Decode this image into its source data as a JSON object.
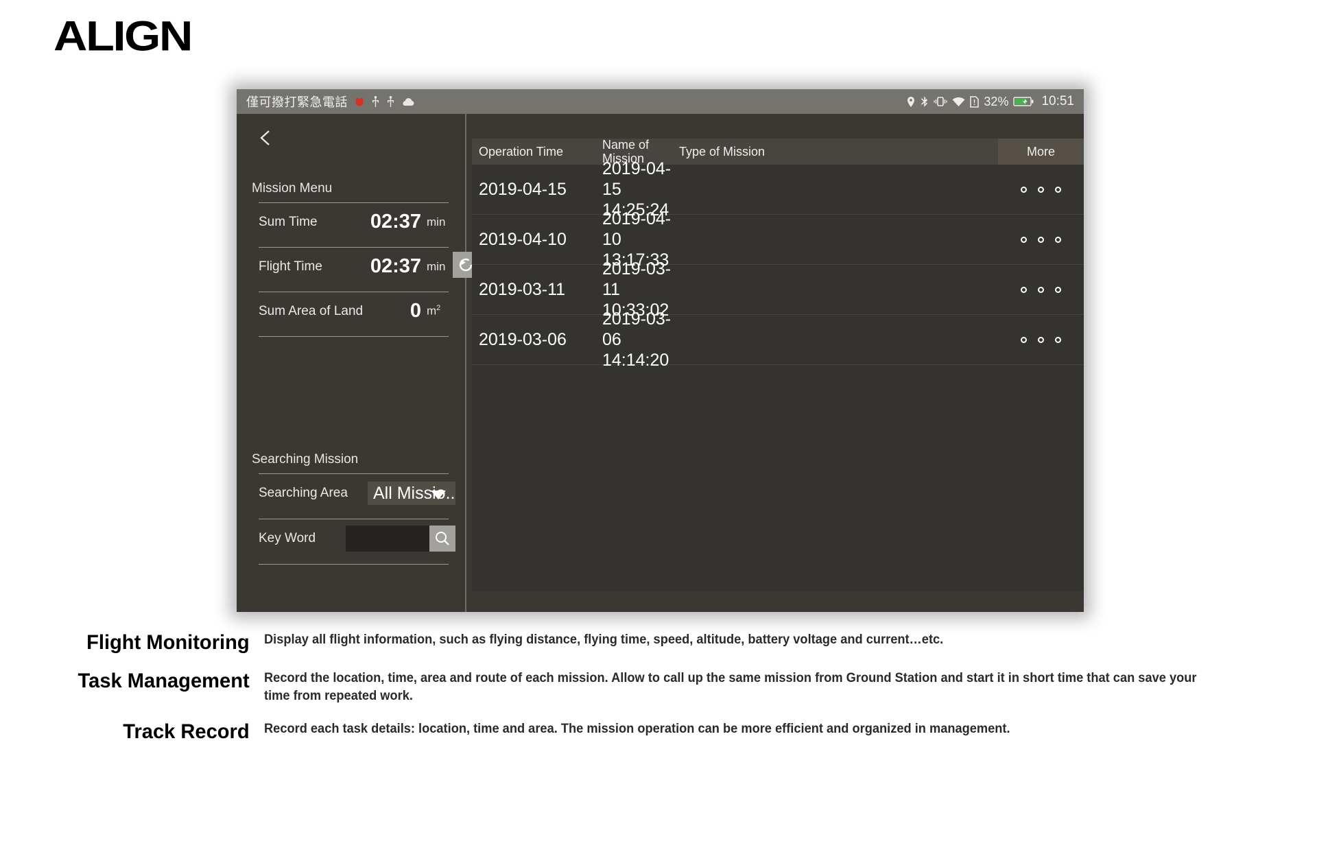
{
  "brand": {
    "logo_text": "ALIGN"
  },
  "statusbar": {
    "carrier_text": "僅可撥打緊急電話",
    "icons_left": [
      "alarm-red-icon",
      "usb-icon",
      "usb-icon",
      "cloud-icon"
    ],
    "icons_right": [
      "location-pin-icon",
      "bluetooth-icon",
      "vibrate-icon",
      "wifi-icon",
      "sim-alert-icon"
    ],
    "battery_percent": "32%",
    "battery_icon": "battery-charging-icon",
    "clock": "10:51"
  },
  "sidebar": {
    "back_icon": "chevron-left-icon",
    "mission_menu_title": "Mission Menu",
    "stats": [
      {
        "label": "Sum Time",
        "value": "02:37",
        "unit": "min",
        "unit_sup": ""
      },
      {
        "label": "Flight Time",
        "value": "02:37",
        "unit": "min",
        "unit_sup": ""
      },
      {
        "label": "Sum Area of Land",
        "value": "0",
        "unit": "m",
        "unit_sup": "2"
      }
    ],
    "refresh_icon": "refresh-icon",
    "searching_title": "Searching Mission",
    "searching_area_label": "Searching Area",
    "searching_area_value": "All Missio..",
    "searching_area_caret": "chevron-down-icon",
    "key_word_label": "Key Word",
    "key_word_value": "",
    "key_word_placeholder": "",
    "search_icon": "search-icon"
  },
  "table": {
    "headers": {
      "operation_time": "Operation Time",
      "name_of_mission": "Name of Mission",
      "type_of_mission": "Type of Mission",
      "more": "More"
    },
    "rows": [
      {
        "operation_time": "2019-04-15",
        "name_of_mission": "2019-04-15 14:25:24",
        "type_of_mission": "",
        "more": "more-dots-icon"
      },
      {
        "operation_time": "2019-04-10",
        "name_of_mission": "2019-04-10 13:17:33",
        "type_of_mission": "",
        "more": "more-dots-icon"
      },
      {
        "operation_time": "2019-03-11",
        "name_of_mission": "2019-03-11 10:33:02",
        "type_of_mission": "",
        "more": "more-dots-icon"
      },
      {
        "operation_time": "2019-03-06",
        "name_of_mission": "2019-03-06 14:14:20",
        "type_of_mission": "",
        "more": "more-dots-icon"
      }
    ]
  },
  "captions": [
    {
      "term": "Flight Monitoring",
      "desc": "Display all flight information, such as flying distance, flying time, speed, altitude, battery voltage and current…etc."
    },
    {
      "term": "Task Management",
      "desc": "Record the location, time, area and route of each mission. Allow to call up the same mission from Ground Station and start it in short time that can save your time from repeated work."
    },
    {
      "term": "Track Record",
      "desc": "Record each task details: location, time and area. The mission operation can be more efficient and organized in management."
    }
  ],
  "colors": {
    "app_bg": "#3b3833",
    "statusbar_bg": "#75736e",
    "table_row_bg": "#353330",
    "table_header_bg": "#484540",
    "accent_button": "#a3a19c"
  }
}
